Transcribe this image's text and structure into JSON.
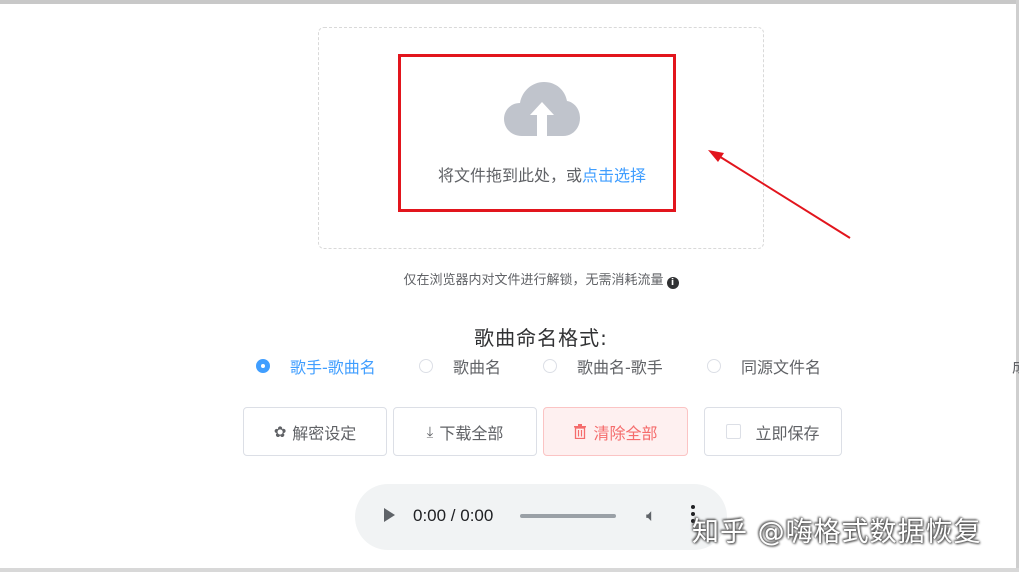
{
  "edge_fragment": "成",
  "upload": {
    "drop_text": "将文件拖到此处，或",
    "select_link": "点击选择",
    "icon": "cloud-upload-icon"
  },
  "tip": {
    "text": "仅在浏览器内对文件进行解锁，无需消耗流量",
    "icon": "info-icon"
  },
  "naming": {
    "title": "歌曲命名格式:",
    "options": [
      "歌手-歌曲名",
      "歌曲名",
      "歌曲名-歌手",
      "同源文件名"
    ],
    "selected": "歌手-歌曲名"
  },
  "buttons": {
    "settings": "解密设定",
    "download_all": "下载全部",
    "clear_all": "清除全部",
    "save_now": "立即保存"
  },
  "player": {
    "time": "0:00 / 0:00"
  },
  "watermark": "知乎 @嗨格式数据恢复",
  "colors": {
    "accent": "#409eff",
    "danger": "#f56c6c",
    "annotation_red": "#e2151d"
  }
}
